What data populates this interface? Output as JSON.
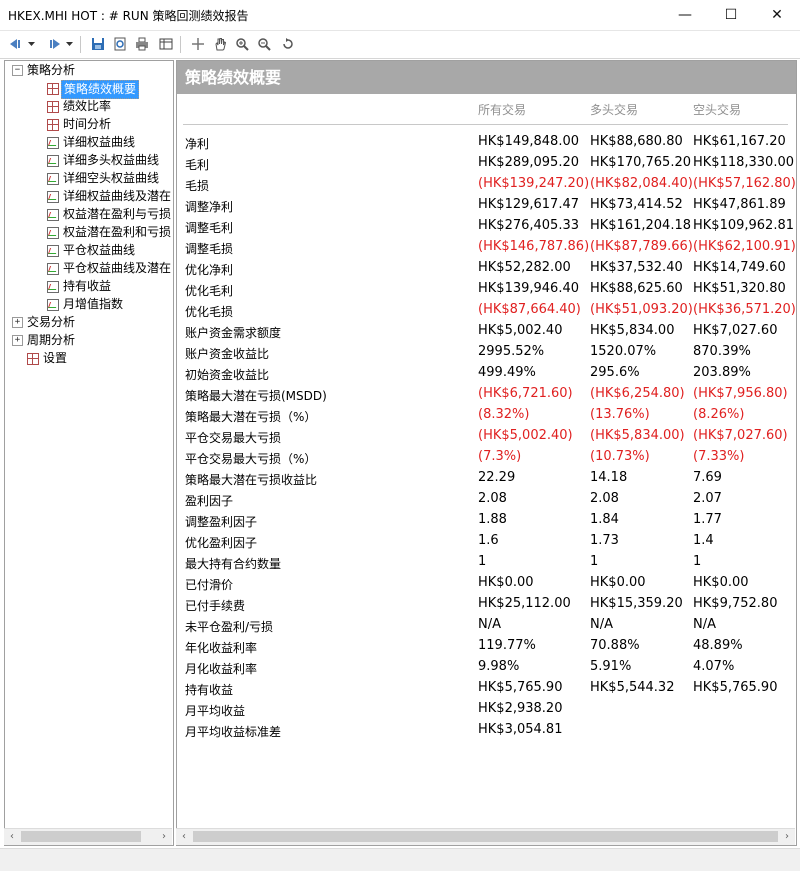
{
  "window": {
    "title": "HKEX.MHI HOT : # RUN 策略回测绩效报告",
    "controls": {
      "minimize": "—",
      "maximize": "☐",
      "close": "✕"
    }
  },
  "toolbar": {
    "icons": [
      "back-icon",
      "dropdown-icon",
      "forward-icon",
      "dropdown-icon",
      "save-icon",
      "preview-icon",
      "print-icon",
      "table-icon",
      "crosshair-icon",
      "hand-icon",
      "zoom-in-icon",
      "zoom-out-icon",
      "reset-zoom-icon"
    ]
  },
  "tree": {
    "group_strategy": "策略分析",
    "strategy_items": [
      {
        "label": "策略绩效概要",
        "icon": "grid",
        "selected": true
      },
      {
        "label": "绩效比率",
        "icon": "grid"
      },
      {
        "label": "时间分析",
        "icon": "grid"
      },
      {
        "label": "详细权益曲线",
        "icon": "chart"
      },
      {
        "label": "详细多头权益曲线",
        "icon": "chart"
      },
      {
        "label": "详细空头权益曲线",
        "icon": "chart"
      },
      {
        "label": "详细权益曲线及潜在",
        "icon": "chart"
      },
      {
        "label": "权益潜在盈利与亏损",
        "icon": "chart"
      },
      {
        "label": "权益潜在盈利和亏损",
        "icon": "chart"
      },
      {
        "label": "平仓权益曲线",
        "icon": "chart"
      },
      {
        "label": "平仓权益曲线及潜在",
        "icon": "chart"
      },
      {
        "label": "持有收益",
        "icon": "chart"
      },
      {
        "label": "月增值指数",
        "icon": "chart"
      }
    ],
    "group_trade": "交易分析",
    "group_period": "周期分析",
    "settings": "设置"
  },
  "report": {
    "section_title": "策略绩效概要",
    "columns": [
      "所有交易",
      "多头交易",
      "空头交易"
    ],
    "rows": [
      {
        "label": "净利",
        "values": [
          "HK$149,848.00",
          "HK$88,680.80",
          "HK$61,167.20"
        ],
        "negative": false
      },
      {
        "label": "毛利",
        "values": [
          "HK$289,095.20",
          "HK$170,765.20",
          "HK$118,330.00"
        ],
        "negative": false
      },
      {
        "label": "毛损",
        "values": [
          "(HK$139,247.20)",
          "(HK$82,084.40)",
          "(HK$57,162.80)"
        ],
        "negative": true
      },
      {
        "label": "调整净利",
        "values": [
          "HK$129,617.47",
          "HK$73,414.52",
          "HK$47,861.89"
        ],
        "negative": false
      },
      {
        "label": "调整毛利",
        "values": [
          "HK$276,405.33",
          "HK$161,204.18",
          "HK$109,962.81"
        ],
        "negative": false
      },
      {
        "label": "调整毛损",
        "values": [
          "(HK$146,787.86)",
          "(HK$87,789.66)",
          "(HK$62,100.91)"
        ],
        "negative": true
      },
      {
        "label": "优化净利",
        "values": [
          "HK$52,282.00",
          "HK$37,532.40",
          "HK$14,749.60"
        ],
        "negative": false
      },
      {
        "label": "优化毛利",
        "values": [
          "HK$139,946.40",
          "HK$88,625.60",
          "HK$51,320.80"
        ],
        "negative": false
      },
      {
        "label": "优化毛损",
        "values": [
          "(HK$87,664.40)",
          "(HK$51,093.20)",
          "(HK$36,571.20)"
        ],
        "negative": true
      },
      {
        "label": "账户资金需求额度",
        "values": [
          "HK$5,002.40",
          "HK$5,834.00",
          "HK$7,027.60"
        ],
        "negative": false
      },
      {
        "label": "账户资金收益比",
        "values": [
          "2995.52%",
          "1520.07%",
          "870.39%"
        ],
        "negative": false
      },
      {
        "label": "初始资金收益比",
        "values": [
          "499.49%",
          "295.6%",
          "203.89%"
        ],
        "negative": false
      },
      {
        "label": "策略最大潜在亏损(MSDD)",
        "values": [
          "(HK$6,721.60)",
          "(HK$6,254.80)",
          "(HK$7,956.80)"
        ],
        "negative": true
      },
      {
        "label": "策略最大潜在亏损（%）",
        "values": [
          "(8.32%)",
          "(13.76%)",
          "(8.26%)"
        ],
        "negative": true
      },
      {
        "label": "平仓交易最大亏损",
        "values": [
          "(HK$5,002.40)",
          "(HK$5,834.00)",
          "(HK$7,027.60)"
        ],
        "negative": true
      },
      {
        "label": "平仓交易最大亏损（%）",
        "values": [
          "(7.3%)",
          "(10.73%)",
          "(7.33%)"
        ],
        "negative": true
      },
      {
        "label": "策略最大潜在亏损收益比",
        "values": [
          "22.29",
          "14.18",
          "7.69"
        ],
        "negative": false
      },
      {
        "label": "盈利因子",
        "values": [
          "2.08",
          "2.08",
          "2.07"
        ],
        "negative": false
      },
      {
        "label": "调整盈利因子",
        "values": [
          "1.88",
          "1.84",
          "1.77"
        ],
        "negative": false
      },
      {
        "label": "优化盈利因子",
        "values": [
          "1.6",
          "1.73",
          "1.4"
        ],
        "negative": false
      },
      {
        "label": "最大持有合约数量",
        "values": [
          "1",
          "1",
          "1"
        ],
        "negative": false
      },
      {
        "label": "已付滑价",
        "values": [
          "HK$0.00",
          "HK$0.00",
          "HK$0.00"
        ],
        "negative": false
      },
      {
        "label": "已付手续费",
        "values": [
          "HK$25,112.00",
          "HK$15,359.20",
          "HK$9,752.80"
        ],
        "negative": false
      },
      {
        "label": "未平仓盈利/亏损",
        "values": [
          "N/A",
          "N/A",
          "N/A"
        ],
        "negative": false
      },
      {
        "label": "年化收益利率",
        "values": [
          "119.77%",
          "70.88%",
          "48.89%"
        ],
        "negative": false
      },
      {
        "label": "月化收益利率",
        "values": [
          "9.98%",
          "5.91%",
          "4.07%"
        ],
        "negative": false
      },
      {
        "label": "持有收益",
        "values": [
          "HK$5,765.90",
          "HK$5,544.32",
          "HK$5,765.90"
        ],
        "negative": false
      },
      {
        "label": "月平均收益",
        "values": [
          "HK$2,938.20",
          "",
          ""
        ],
        "negative": false
      },
      {
        "label": "月平均收益标准差",
        "values": [
          "HK$3,054.81",
          "",
          ""
        ],
        "negative": false
      }
    ]
  },
  "colors": {
    "negative": "#e02020",
    "header_bg": "#a8a8a8",
    "selection": "#3399ff"
  }
}
